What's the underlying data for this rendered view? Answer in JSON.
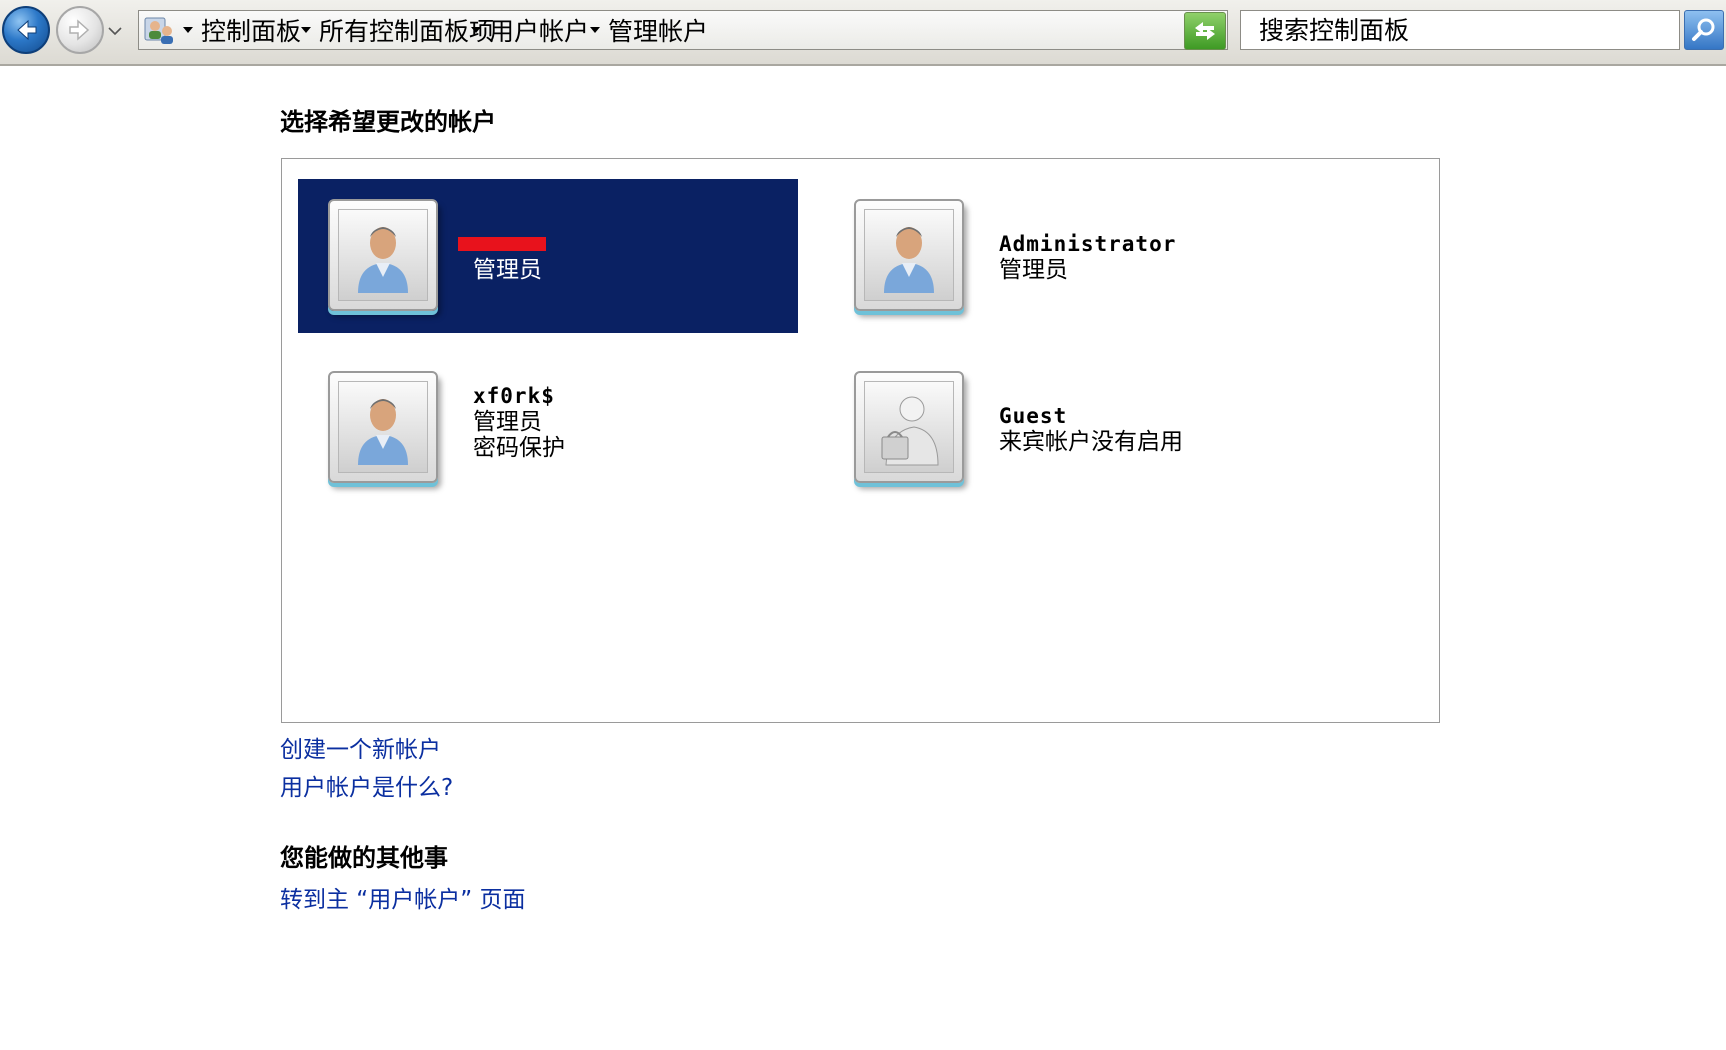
{
  "address_bar": {
    "breadcrumbs": [
      "控制面板",
      "所有控制面板项",
      "用户帐户",
      "管理帐户"
    ],
    "icons": {
      "back": "back-arrow-icon",
      "forward": "forward-arrow-icon",
      "location": "control-panel-users-icon",
      "refresh": "refresh-icon",
      "search": "search-icon"
    }
  },
  "search": {
    "placeholder": "搜索控制面板"
  },
  "main": {
    "heading": "选择希望更改的帐户",
    "accounts": [
      {
        "name": "",
        "lines": [
          "管理员"
        ],
        "selected": true,
        "name_redacted": true,
        "avatar": "user-avatar-icon"
      },
      {
        "name": "Administrator",
        "lines": [
          "管理员"
        ],
        "selected": false,
        "avatar": "user-avatar-icon"
      },
      {
        "name": "xf0rk$",
        "lines": [
          "管理员",
          "密码保护"
        ],
        "selected": false,
        "avatar": "user-avatar-icon"
      },
      {
        "name": "Guest",
        "lines": [
          "来宾帐户没有启用"
        ],
        "selected": false,
        "avatar": "guest-avatar-icon"
      }
    ],
    "links": [
      "创建一个新帐户",
      "用户帐户是什么?"
    ],
    "other_heading": "您能做的其他事",
    "other_links": [
      "转到主 “用户帐户” 页面"
    ]
  },
  "colors": {
    "selected_bg": "#0a2163",
    "link": "#0b2fa0",
    "redaction": "#e8121c"
  }
}
